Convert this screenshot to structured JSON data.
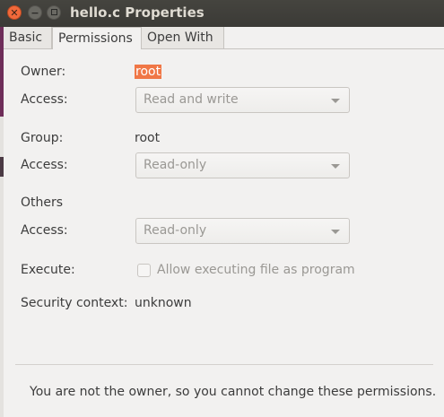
{
  "window": {
    "title": "hello.c Properties",
    "close_glyph": "✕",
    "minimize_glyph": "−"
  },
  "tabs": [
    {
      "label": "Basic"
    },
    {
      "label": "Permissions"
    },
    {
      "label": "Open With"
    }
  ],
  "permissions": {
    "owner_label": "Owner:",
    "owner_value": "root",
    "owner_access_label": "Access:",
    "owner_access_value": "Read and write",
    "group_label": "Group:",
    "group_value": "root",
    "group_access_label": "Access:",
    "group_access_value": "Read-only",
    "others_label": "Others",
    "others_access_label": "Access:",
    "others_access_value": "Read-only",
    "execute_label": "Execute:",
    "execute_checkbox_label": "Allow executing file as program",
    "security_label": "Security context:",
    "security_value": "unknown"
  },
  "notice": "You are not the owner, so you cannot change these permissions.",
  "colors": {
    "titlebar": "#3b3a36",
    "close_button": "#f1693b",
    "selection": "#f07746",
    "window_bg": "#f2f1f0"
  }
}
